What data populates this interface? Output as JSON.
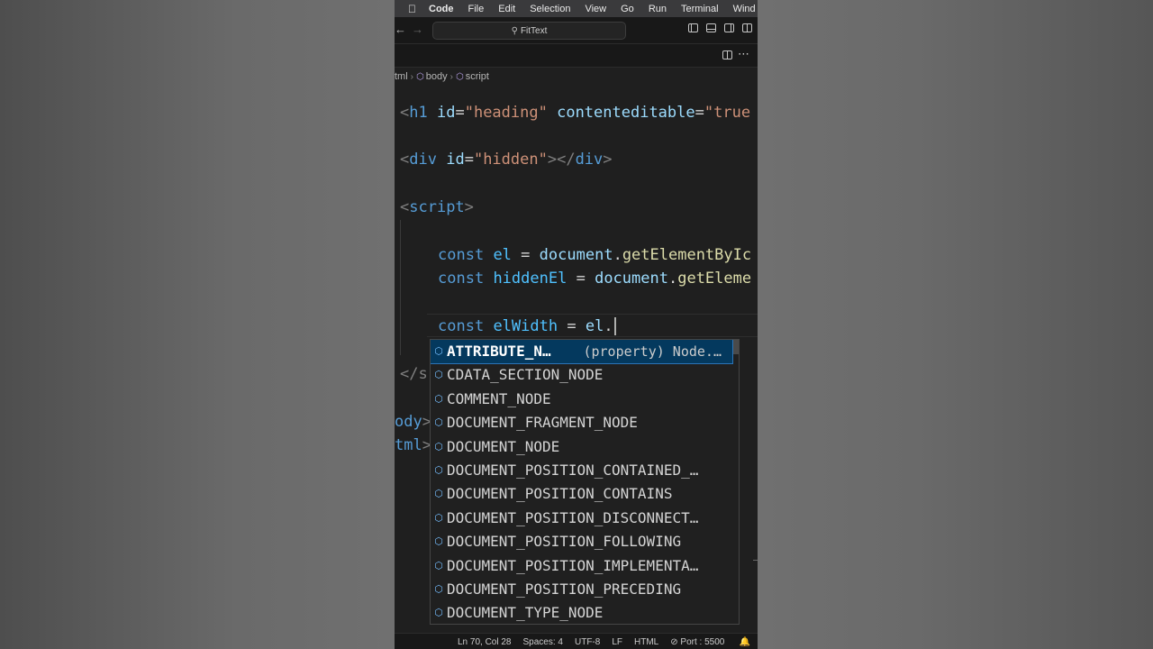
{
  "menubar": {
    "app": "Code",
    "items": [
      "File",
      "Edit",
      "Selection",
      "View",
      "Go",
      "Run",
      "Terminal",
      "Wind"
    ]
  },
  "titlebar": {
    "search": "FitText"
  },
  "breadcrumb": [
    "tml",
    "body",
    "script"
  ],
  "code": {
    "l1_open": "<",
    "l1_tag": "h1",
    "l1_attr1": "id",
    "l1_eq": "=",
    "l1_val1": "\"heading\"",
    "l1_attr2": "contenteditable",
    "l1_val2": "\"true",
    "l2_tag": "div",
    "l2_attr": "id",
    "l2_val": "\"hidden\"",
    "l2_close": "div",
    "l3_tag": "script",
    "l4_kw": "const",
    "l4_var": "el",
    "l4_obj": "document",
    "l4_fn": "getElementByIc",
    "l5_kw": "const",
    "l5_var": "hiddenEl",
    "l5_obj": "document",
    "l5_fn": "getEleme",
    "l6_kw": "const",
    "l6_var": "elWidth",
    "l6_obj": "el",
    "l7_frag": "</s",
    "l8_frag": "ody",
    "l9_frag": "tml"
  },
  "suggest": {
    "items": [
      {
        "label": "ATTRIBUTE_N…",
        "detail": "(property) Node.…"
      },
      {
        "label": "CDATA_SECTION_NODE",
        "detail": ""
      },
      {
        "label": "COMMENT_NODE",
        "detail": ""
      },
      {
        "label": "DOCUMENT_FRAGMENT_NODE",
        "detail": ""
      },
      {
        "label": "DOCUMENT_NODE",
        "detail": ""
      },
      {
        "label": "DOCUMENT_POSITION_CONTAINED_…",
        "detail": ""
      },
      {
        "label": "DOCUMENT_POSITION_CONTAINS",
        "detail": ""
      },
      {
        "label": "DOCUMENT_POSITION_DISCONNECT…",
        "detail": ""
      },
      {
        "label": "DOCUMENT_POSITION_FOLLOWING",
        "detail": ""
      },
      {
        "label": "DOCUMENT_POSITION_IMPLEMENTA…",
        "detail": ""
      },
      {
        "label": "DOCUMENT_POSITION_PRECEDING",
        "detail": ""
      },
      {
        "label": "DOCUMENT_TYPE_NODE",
        "detail": ""
      }
    ]
  },
  "statusbar": {
    "position": "Ln 70, Col 28",
    "spaces": "Spaces: 4",
    "encoding": "UTF-8",
    "eol": "LF",
    "language": "HTML",
    "port": "Port : 5500"
  },
  "colors": {
    "editor_bg": "#1f1f1f",
    "selection": "#04395e",
    "keyword": "#569cd6",
    "string": "#ce9178",
    "attribute": "#9cdcfe",
    "function": "#dcdcaa"
  }
}
